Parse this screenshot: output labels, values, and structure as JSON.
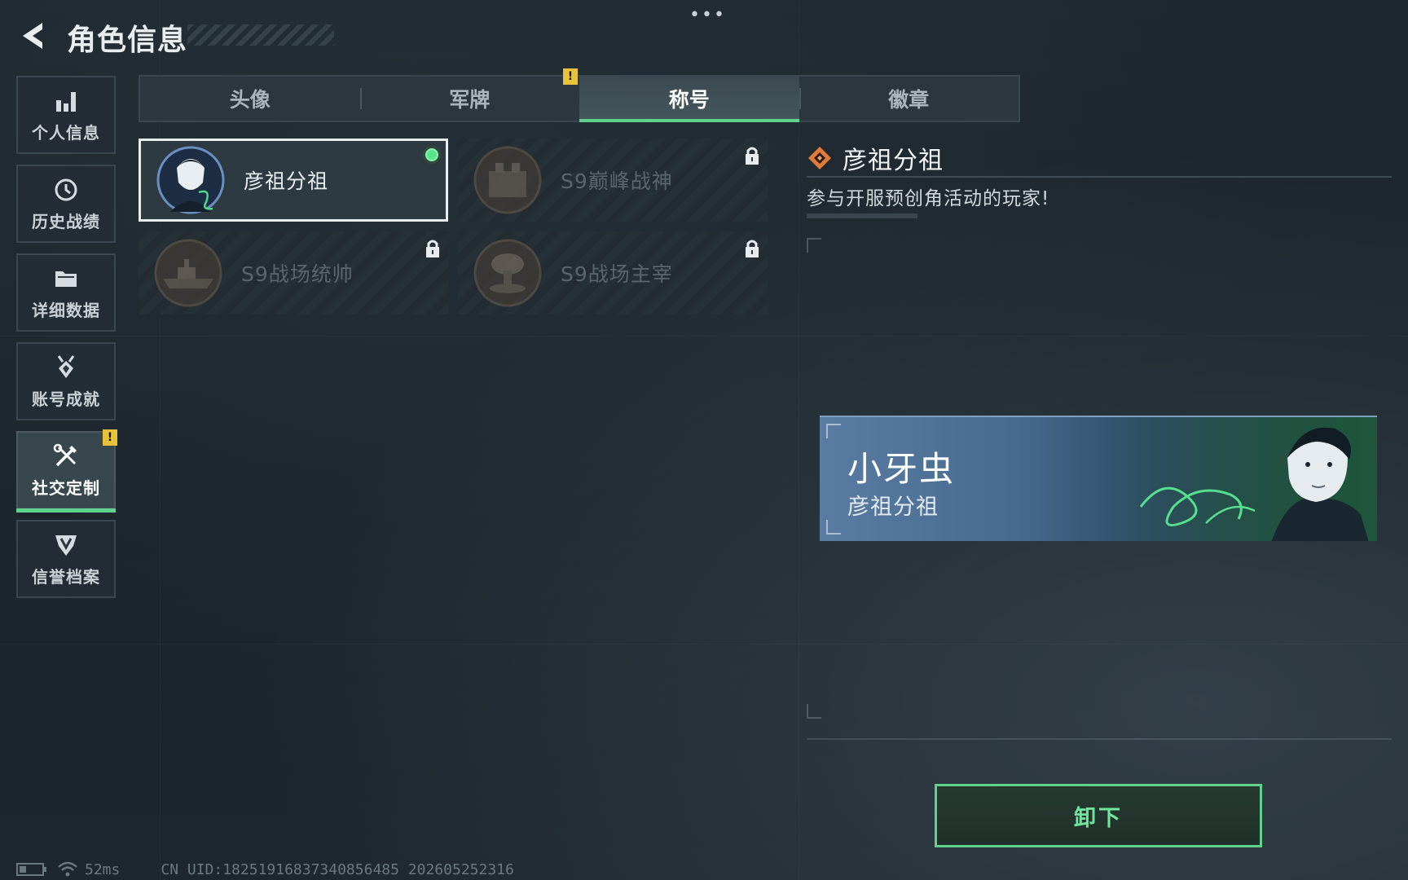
{
  "header": {
    "more": "•••",
    "title": "角色信息"
  },
  "sidebar": {
    "items": [
      {
        "label": "个人信息",
        "icon": "bar-chart-icon",
        "active": false
      },
      {
        "label": "历史战绩",
        "icon": "clock-icon",
        "active": false
      },
      {
        "label": "详细数据",
        "icon": "folder-icon",
        "active": false
      },
      {
        "label": "账号成就",
        "icon": "medal-icon",
        "active": false
      },
      {
        "label": "社交定制",
        "icon": "tools-icon",
        "active": true,
        "alert": "!"
      },
      {
        "label": "信誉档案",
        "icon": "shield-icon",
        "active": false
      }
    ]
  },
  "tabs": {
    "items": [
      {
        "label": "头像",
        "active": false
      },
      {
        "label": "军牌",
        "active": false,
        "alert": "!"
      },
      {
        "label": "称号",
        "active": true
      },
      {
        "label": "徽章",
        "active": false
      }
    ]
  },
  "titles": {
    "items": [
      {
        "name": "彦祖分祖",
        "locked": false,
        "equipped": true,
        "selected": true,
        "emblem": "portrait-icon"
      },
      {
        "name": "S9巅峰战神",
        "locked": true,
        "equipped": false,
        "selected": false,
        "emblem": "fortress-icon"
      },
      {
        "name": "S9战场统帅",
        "locked": true,
        "equipped": false,
        "selected": false,
        "emblem": "warship-icon"
      },
      {
        "name": "S9战场主宰",
        "locked": true,
        "equipped": false,
        "selected": false,
        "emblem": "mushroom-cloud-icon"
      }
    ]
  },
  "detail": {
    "title": "彦祖分祖",
    "description": "参与开服预创角活动的玩家!",
    "icon": "diamond-icon"
  },
  "preview": {
    "player_name": "小牙虫",
    "title": "彦祖分祖"
  },
  "actions": {
    "unequip_label": "卸下"
  },
  "status": {
    "ping": "52ms",
    "uid": "CN UID:18251916837340856485 202605252316"
  },
  "colors": {
    "accent_green": "#5fd38b",
    "alert_yellow": "#e8c23a",
    "title_orange": "#e07a3a"
  }
}
